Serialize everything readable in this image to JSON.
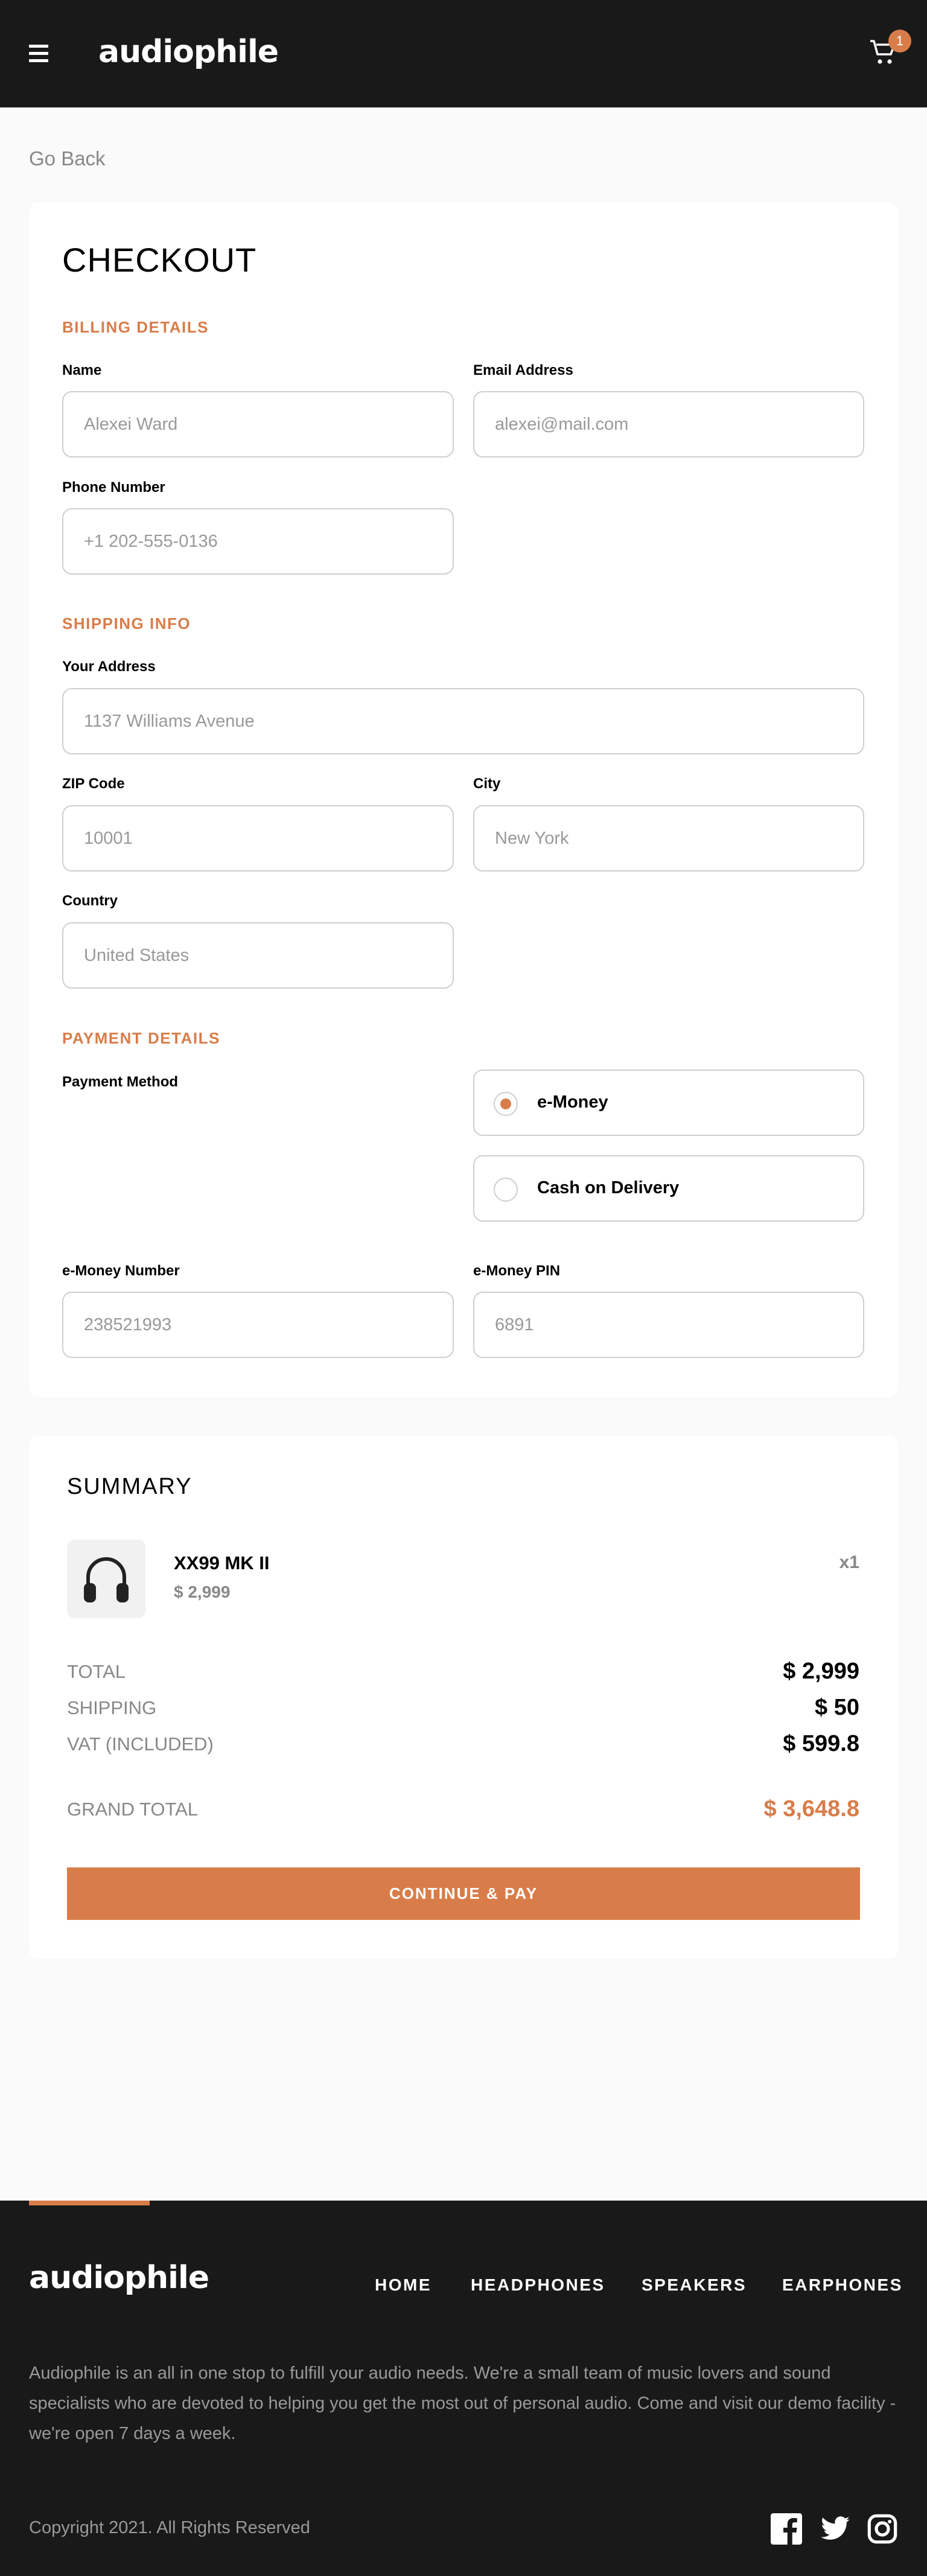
{
  "header": {
    "brand": "audiophile",
    "cart_count": "1"
  },
  "nav": {
    "go_back": "Go Back"
  },
  "checkout": {
    "title": "CHECKOUT",
    "billing": {
      "title": "BILLING DETAILS",
      "name_label": "Name",
      "name_placeholder": "Alexei Ward",
      "email_label": "Email Address",
      "email_placeholder": "alexei@mail.com",
      "phone_label": "Phone Number",
      "phone_placeholder": "+1 202-555-0136"
    },
    "shipping": {
      "title": "SHIPPING INFO",
      "address_label": "Your Address",
      "address_placeholder": "1137 Williams Avenue",
      "zip_label": "ZIP Code",
      "zip_placeholder": "10001",
      "city_label": "City",
      "city_placeholder": "New York",
      "country_label": "Country",
      "country_placeholder": "United States"
    },
    "payment": {
      "title": "PAYMENT DETAILS",
      "method_label": "Payment Method",
      "options": [
        "e-Money",
        "Cash on Delivery"
      ],
      "selected": "e-Money",
      "emoney_number_label": "e-Money Number",
      "emoney_number_placeholder": "238521993",
      "emoney_pin_label": "e-Money PIN",
      "emoney_pin_placeholder": "6891"
    }
  },
  "summary": {
    "title": "SUMMARY",
    "items": [
      {
        "name": "XX99 MK II",
        "price": "$ 2,999",
        "qty": "x1"
      }
    ],
    "total_label": "TOTAL",
    "total_value": "$ 2,999",
    "shipping_label": "SHIPPING",
    "shipping_value": "$ 50",
    "vat_label": "VAT (INCLUDED)",
    "vat_value": "$ 599.8",
    "grand_label": "GRAND TOTAL",
    "grand_value": "$ 3,648.8",
    "pay_button": "CONTINUE & PAY"
  },
  "footer": {
    "brand": "audiophile",
    "links": [
      "HOME",
      "HEADPHONES",
      "SPEAKERS",
      "EARPHONES"
    ],
    "about": "Audiophile is an all in one stop to fulfill your audio needs. We're a small team of music lovers and sound specialists who are devoted to helping you get the most out of personal audio. Come and visit our demo facility - we're open 7 days a week.",
    "copyright": "Copyright 2021. All Rights Reserved",
    "social": [
      "facebook-icon",
      "twitter-icon",
      "instagram-icon"
    ]
  },
  "colors": {
    "accent": "#d87d4a",
    "dark": "#191919",
    "background": "#fafafa"
  }
}
